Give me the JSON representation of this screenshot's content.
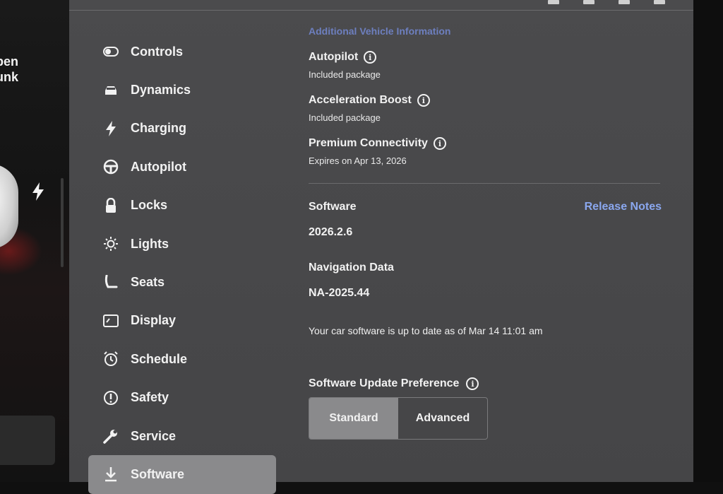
{
  "car_view": {
    "trunk_label": "pen\nunk"
  },
  "sidebar": {
    "items": [
      {
        "label": "Controls",
        "icon": "toggle-icon"
      },
      {
        "label": "Dynamics",
        "icon": "car-icon"
      },
      {
        "label": "Charging",
        "icon": "bolt-icon"
      },
      {
        "label": "Autopilot",
        "icon": "steering-wheel-icon"
      },
      {
        "label": "Locks",
        "icon": "lock-icon"
      },
      {
        "label": "Lights",
        "icon": "sun-icon"
      },
      {
        "label": "Seats",
        "icon": "seat-icon"
      },
      {
        "label": "Display",
        "icon": "display-icon"
      },
      {
        "label": "Schedule",
        "icon": "alarm-icon"
      },
      {
        "label": "Safety",
        "icon": "alert-icon"
      },
      {
        "label": "Service",
        "icon": "wrench-icon"
      },
      {
        "label": "Software",
        "icon": "download-icon",
        "active": true
      }
    ]
  },
  "content": {
    "section_title": "Additional Vehicle Information",
    "features": [
      {
        "title": "Autopilot",
        "subtitle": "Included package"
      },
      {
        "title": "Acceleration Boost",
        "subtitle": "Included package"
      },
      {
        "title": "Premium Connectivity",
        "subtitle": "Expires on Apr 13, 2026"
      }
    ],
    "software_label": "Software",
    "release_notes_link": "Release Notes",
    "software_version": "2026.2.6",
    "nav_data_label": "Navigation Data",
    "nav_data_version": "NA-2025.44",
    "update_status": "Your car software is up to date as of Mar 14 11:01 am",
    "update_pref_label": "Software Update Preference",
    "update_pref_options": [
      "Standard",
      "Advanced"
    ],
    "update_pref_selected": "Standard"
  },
  "colors": {
    "accent_link": "#8aa7ee",
    "panel_bg": "#4a4a4c",
    "active_bg": "#8a8a8c"
  }
}
